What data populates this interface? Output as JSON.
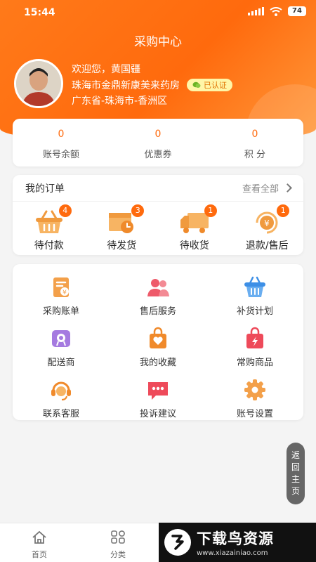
{
  "status": {
    "time": "15:44",
    "battery": "74"
  },
  "header": {
    "title": "采购中心",
    "welcome": "欢迎您，黄国疆",
    "store": "珠海市金鼎新康美来药房",
    "verified": "已认证",
    "location": "广东省-珠海市-香洲区"
  },
  "stats": [
    {
      "value": "0",
      "label": "账号余额"
    },
    {
      "value": "0",
      "label": "优惠券"
    },
    {
      "value": "0",
      "label": "积 分"
    }
  ],
  "orders": {
    "title": "我的订单",
    "view_all": "查看全部",
    "items": [
      {
        "label": "待付款",
        "badge": "4",
        "icon": "basket-icon"
      },
      {
        "label": "待发货",
        "badge": "3",
        "icon": "box-clock-icon"
      },
      {
        "label": "待收货",
        "badge": "1",
        "icon": "truck-icon"
      },
      {
        "label": "退款/售后",
        "badge": "1",
        "icon": "refund-icon"
      }
    ]
  },
  "services": [
    {
      "label": "采购账单",
      "icon": "bill-icon"
    },
    {
      "label": "售后服务",
      "icon": "users-icon"
    },
    {
      "label": "补货计划",
      "icon": "basket-icon"
    },
    {
      "label": "配送商",
      "icon": "badge-icon"
    },
    {
      "label": "我的收藏",
      "icon": "heart-bag-icon"
    },
    {
      "label": "常购商品",
      "icon": "flash-bag-icon"
    },
    {
      "label": "联系客服",
      "icon": "headset-icon"
    },
    {
      "label": "投诉建议",
      "icon": "chat-icon"
    },
    {
      "label": "账号设置",
      "icon": "gear-icon"
    }
  ],
  "float_button": {
    "chars": [
      "返",
      "回",
      "主",
      "页"
    ]
  },
  "tabbar": [
    {
      "label": "首页",
      "icon": "home-icon"
    },
    {
      "label": "分类",
      "icon": "grid-icon"
    }
  ],
  "watermark": {
    "title": "下载鸟资源",
    "url": "www.xiazainiao.com"
  },
  "colors": {
    "accent": "#ff6a0d",
    "badge": "#ff6a0d"
  }
}
